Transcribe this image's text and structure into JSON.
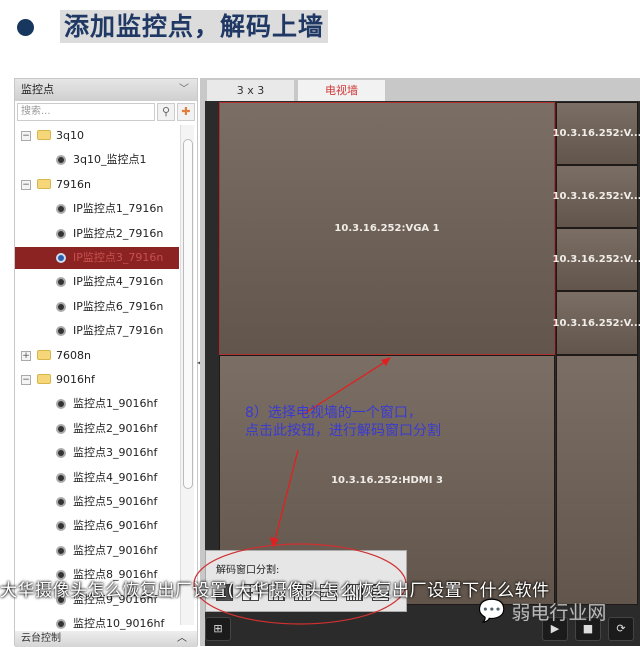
{
  "slide": {
    "title": "添加监控点，解码上墙"
  },
  "left_panel": {
    "header": "监控点",
    "search_placeholder": "搜索...",
    "tree": [
      {
        "label": "3q10",
        "type": "folder",
        "expanded": true,
        "level": 0
      },
      {
        "label": "3q10_监控点1",
        "type": "camera",
        "level": 1
      },
      {
        "label": "7916n",
        "type": "folder",
        "expanded": true,
        "level": 0
      },
      {
        "label": "IP监控点1_7916n",
        "type": "camera",
        "level": 1
      },
      {
        "label": "IP监控点2_7916n",
        "type": "camera",
        "level": 1
      },
      {
        "label": "IP监控点3_7916n",
        "type": "camera",
        "level": 1,
        "selected": true
      },
      {
        "label": "IP监控点4_7916n",
        "type": "camera",
        "level": 1
      },
      {
        "label": "IP监控点6_7916n",
        "type": "camera",
        "level": 1
      },
      {
        "label": "IP监控点7_7916n",
        "type": "camera",
        "level": 1
      },
      {
        "label": "7608n",
        "type": "folder",
        "expanded": false,
        "level": 0
      },
      {
        "label": "9016hf",
        "type": "folder",
        "expanded": true,
        "level": 0
      },
      {
        "label": "监控点1_9016hf",
        "type": "camera",
        "level": 1
      },
      {
        "label": "监控点2_9016hf",
        "type": "camera",
        "level": 1
      },
      {
        "label": "监控点3_9016hf",
        "type": "camera",
        "level": 1
      },
      {
        "label": "监控点4_9016hf",
        "type": "camera",
        "level": 1
      },
      {
        "label": "监控点5_9016hf",
        "type": "camera",
        "level": 1
      },
      {
        "label": "监控点6_9016hf",
        "type": "camera",
        "level": 1
      },
      {
        "label": "监控点7_9016hf",
        "type": "camera",
        "level": 1
      },
      {
        "label": "监控点8_9016hf",
        "type": "camera",
        "level": 1
      },
      {
        "label": "监控点9_9016hf",
        "type": "camera",
        "level": 1
      },
      {
        "label": "监控点10_9016hf",
        "type": "camera",
        "level": 1
      }
    ],
    "footer": "云台控制"
  },
  "tabs": [
    {
      "label": "3 x 3"
    },
    {
      "label": "电视墙",
      "active": true
    }
  ],
  "wall": {
    "main": "10.3.16.252:VGA 1",
    "side": [
      "10.3.16.252:V...",
      "10.3.16.252:V...",
      "10.3.16.252:V...",
      "10.3.16.252:V..."
    ],
    "bottom": "10.3.16.252:HDMI 3"
  },
  "popup": {
    "label": "解码窗口分割:"
  },
  "annotation": {
    "line1": "8）选择电视墙的一个窗口，",
    "line2": "点击此按钮，进行解码窗口分割"
  },
  "toolbar": {
    "play": "▶",
    "stop": "■",
    "refresh": "⟳",
    "layout": "⊞"
  },
  "watermark": {
    "caption": "大华摄像头怎么恢复出厂设置(大华摄像头怎么恢复出厂设置下什么软件",
    "brand": "弱电行业网"
  },
  "colors": {
    "accent": "#d03a3a",
    "selected_row": "#8b2323",
    "annotation": "#3a3ad0"
  }
}
